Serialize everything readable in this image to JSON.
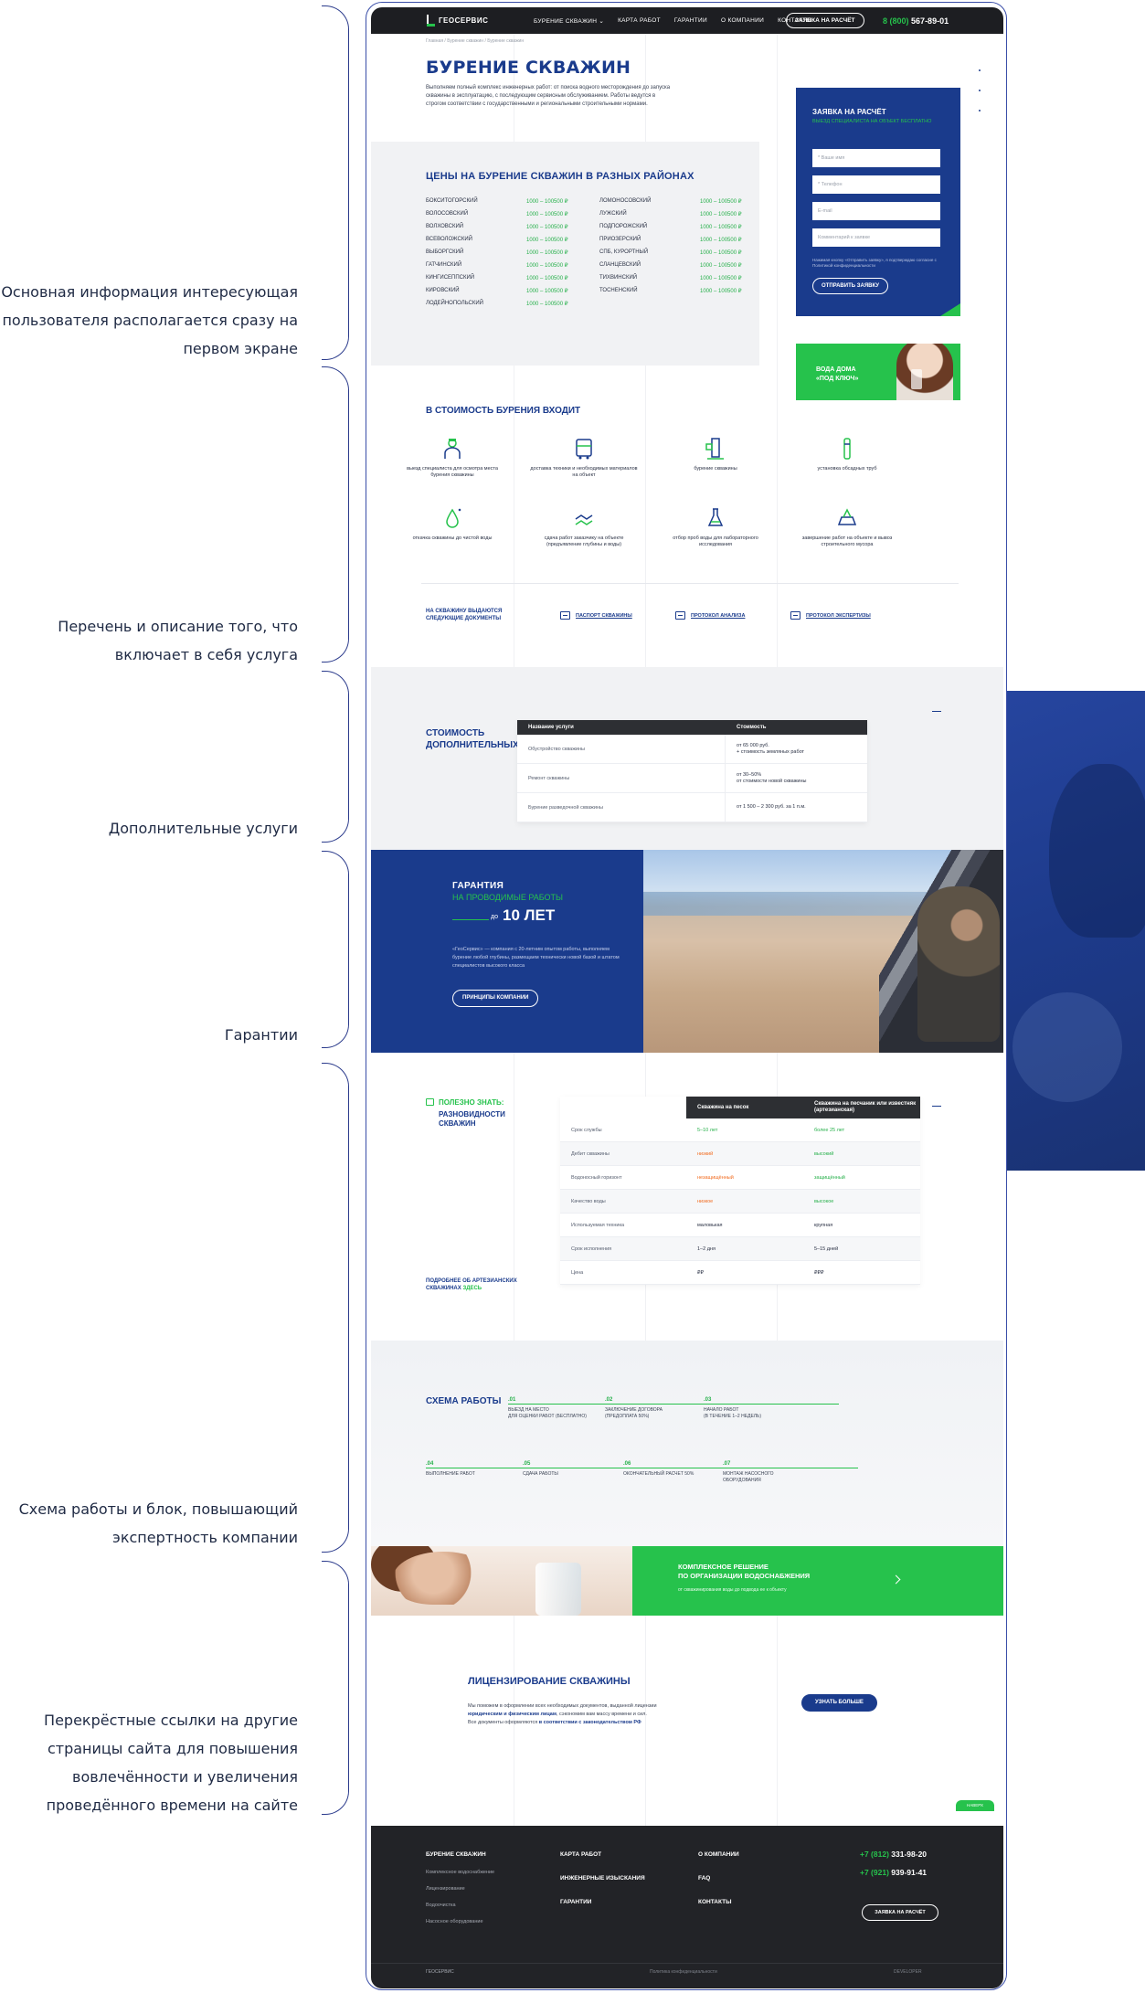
{
  "annotations": [
    "Основная информация интересующая пользователя располагается сразу на первом экране",
    "Перечень и описание того, что включает в себя услуга",
    "Дополнительные услуги",
    "Гарантии",
    "Схема работы и блок, повышающий экспертность компании",
    "Перекрёстные ссылки на другие страницы сайта для повышения вовлечённости и увеличения проведённого времени на сайте"
  ],
  "header": {
    "logo": "ГЕОСЕРВИС",
    "nav": [
      "БУРЕНИЕ СКВАЖИН ⌄",
      "КАРТА РАБОТ",
      "ГАРАНТИИ",
      "О КОМПАНИИ",
      "КОНТАКТЫ"
    ],
    "cta": "ЗАЯВКА НА РАСЧЁТ",
    "phone_prefix": "8 (800)",
    "phone": "567-89-01"
  },
  "breadcrumbs": "Главная / Бурение скважин / Бурение скважин",
  "hero": {
    "title": "БУРЕНИЕ СКВАЖИН",
    "lead": "Выполняем полный комплекс инженерных работ: от поиска водного месторождения до запуска скважины в эксплуатацию, с последующим сервисным обслуживанием. Работы ведутся в строгом соответствии с государственными и региональными строительными нормами."
  },
  "prices": {
    "title": "ЦЕНЫ НА БУРЕНИЕ СКВАЖИН В РАЗНЫХ РАЙОНАХ",
    "left": [
      [
        "БОКСИТОГОРСКИЙ",
        "1000 – 100500 ₽"
      ],
      [
        "ВОЛОСОВСКИЙ",
        "1000 – 100500 ₽"
      ],
      [
        "ВОЛХОВСКИЙ",
        "1000 – 100500 ₽"
      ],
      [
        "ВСЕВОЛОЖСКИЙ",
        "1000 – 100500 ₽"
      ],
      [
        "ВЫБОРГСКИЙ",
        "1000 – 100500 ₽"
      ],
      [
        "ГАТЧИНСКИЙ",
        "1000 – 100500 ₽"
      ],
      [
        "КИНГИСЕППСКИЙ",
        "1000 – 100500 ₽"
      ],
      [
        "КИРОВСКИЙ",
        "1000 – 100500 ₽"
      ],
      [
        "ЛОДЕЙНОПОЛЬСКИЙ",
        "1000 – 100500 ₽"
      ]
    ],
    "right": [
      [
        "ЛОМОНОСОВСКИЙ",
        "1000 – 100500 ₽"
      ],
      [
        "ЛУЖСКИЙ",
        "1000 – 100500 ₽"
      ],
      [
        "ПОДПОРОЖСКИЙ",
        "1000 – 100500 ₽"
      ],
      [
        "ПРИОЗЕРСКИЙ",
        "1000 – 100500 ₽"
      ],
      [
        "СПБ, КУРОРТНЫЙ",
        "1000 – 100500 ₽"
      ],
      [
        "СЛАНЦЕВСКИЙ",
        "1000 – 100500 ₽"
      ],
      [
        "ТИХВИНСКИЙ",
        "1000 – 100500 ₽"
      ],
      [
        "ТОСНЕНСКИЙ",
        "1000 – 100500 ₽"
      ]
    ]
  },
  "form": {
    "title": "ЗАЯВКА НА РАСЧЁТ",
    "subtitle": "ВЫЕЗД СПЕЦИАЛИСТА НА ОБЪЕКТ БЕСПЛАТНО",
    "fields": [
      "* Ваше имя",
      "* Телефон",
      "E-mail",
      "Комментарий к заявке"
    ],
    "note": "Нажимая кнопку «Отправить заявку», я подтверждаю согласие с Политикой конфиденциальности",
    "button": "ОТПРАВИТЬ ЗАЯВКУ"
  },
  "promo": {
    "line1": "ВОДА ДОМА",
    "line2": "«ПОД КЛЮЧ»"
  },
  "includes": {
    "title": "В СТОИМОСТЬ БУРЕНИЯ ВХОДИТ",
    "items": [
      "выезд специалиста для осмотра места бурения скважины",
      "доставка техники и необходимых материалов на объект",
      "бурение скважины",
      "установка обсадных труб",
      "откачка скважины до чистой воды",
      "сдача работ заказчику на объекте (предъявление глубины и воды)",
      "отбор проб воды для лабораторного исследования",
      "завершение работ на объекте и вывоз строительного мусора"
    ],
    "docs_title_1": "НА СКВАЖИНУ ВЫДАЮТСЯ",
    "docs_title_2": "СЛЕДУЮЩИЕ ДОКУМЕНТЫ",
    "docs": [
      "ПАСПОРТ СКВАЖИНЫ",
      "ПРОТОКОЛ АНАЛИЗА",
      "ПРОТОКОЛ ЭКСПЕРТИЗЫ"
    ]
  },
  "additional": {
    "title_1": "СТОИМОСТЬ",
    "title_2": "ДОПОЛНИТЕЛЬНЫХ РАБОТ",
    "head": [
      "Название услуги",
      "Стоимость"
    ],
    "rows": [
      [
        "Обустройство скважины",
        "от 65 000 руб.",
        "+ стоимость земляных работ"
      ],
      [
        "Ремонт скважины",
        "от 30–50%",
        "от стоимости новой скважины"
      ],
      [
        "Бурение разведочной скважины",
        "от 1 500 – 2 300 руб. за 1 п.м.",
        ""
      ]
    ]
  },
  "guarantee": {
    "title": "ГАРАНТИЯ",
    "subtitle": "НА ПРОВОДИМЫЕ РАБОТЫ",
    "do": "до",
    "years": "10 ЛЕТ",
    "desc": "«ГеоСервис» — компания с 20-летним опытом работы, выполняем бурение любой глубины, размещаем технически новой базой и штатом специалистов высокого класса",
    "button": "ПРИНЦИПЫ КОМПАНИИ"
  },
  "types": {
    "label": "ПОЛЕЗНО ЗНАТЬ:",
    "title_1": "РАЗНОВИДНОСТИ",
    "title_2": "СКВАЖИН",
    "more_1": "ПОДРОБНЕЕ ОБ АРТЕЗИАНСКИХ",
    "more_2": "СКВАЖИНАХ",
    "more_link": "ЗДЕСЬ",
    "head": [
      "",
      "Скважина на песок",
      "Скважина на песчаник или известняк (артезианская)"
    ],
    "rows": [
      [
        "Срок службы",
        "5–10 лет",
        "g",
        "более 25 лет",
        "g"
      ],
      [
        "Дебит скважины",
        "низкий",
        "o",
        "высокий",
        "g"
      ],
      [
        "Водоносный горизонт",
        "незащищённый",
        "o",
        "защищённый",
        "g"
      ],
      [
        "Качество воды",
        "низкое",
        "o",
        "высокое",
        "g"
      ],
      [
        "Используемая техника",
        "маловькая",
        "d",
        "крупная",
        "d"
      ],
      [
        "Срок исполнения",
        "1–2 дня",
        "d",
        "5–15 дней",
        "d"
      ],
      [
        "Цена",
        "₽₽",
        "d",
        "₽₽₽",
        "d"
      ]
    ]
  },
  "scheme": {
    "title": "СХЕМА РАБОТЫ",
    "steps": [
      [
        ".01",
        "ВЫЕЗД НА МЕСТО",
        "ДЛЯ ОЦЕНКИ РАБОТ (БЕСПЛАТНО)"
      ],
      [
        ".02",
        "ЗАКЛЮЧЕНИЕ ДОГОВОРА",
        "(ПРЕДОПЛАТА 50%)"
      ],
      [
        ".03",
        "НАЧАЛО РАБОТ",
        "(В ТЕЧЕНИЕ 1–2 НЕДЕЛЬ)"
      ],
      [
        ".04",
        "ВЫПОЛНЕНИЕ РАБОТ",
        ""
      ],
      [
        ".05",
        "СДАЧА РАБОТЫ",
        ""
      ],
      [
        ".06",
        "ОКОНЧАТЕЛЬНЫЙ РАСЧЕТ 50%",
        ""
      ],
      [
        ".07",
        "МОНТАЖ НАСОСНОГО",
        "ОБОРУДОВАНИЯ"
      ]
    ]
  },
  "complex": {
    "title_1": "КОМПЛЕКСНОЕ РЕШЕНИЕ",
    "title_2": "ПО ОРГАНИЗАЦИИ ВОДОСНАБЖЕНИЯ",
    "subtitle": "от скважинирования воды до подвода ее к объекту"
  },
  "license": {
    "title": "ЛИЦЕНЗИРОВАНИЕ СКВАЖИНЫ",
    "p1": "Мы поможем в оформлении всех необходимых документов, выданной лицензии",
    "p2a": "юридическим и физическим лицам",
    "p2b": ", сэкономим вам массу времени и сил.",
    "p3a": "Все документы оформляются ",
    "p3b": "в соответствии с законодательством РФ",
    "button": "УЗНАТЬ БОЛЬШЕ",
    "up": "НАВЕРХ"
  },
  "footer": {
    "col1_title": "БУРЕНИЕ СКВАЖИН",
    "col1_items": [
      "Комплексное водоснабжение",
      "Лицензирование",
      "Водоочистка",
      "Насосное оборудование"
    ],
    "col2": [
      "КАРТА РАБОТ",
      "ИНЖЕНЕРНЫЕ ИЗЫСКАНИЯ",
      "ГАРАНТИИ"
    ],
    "col3": [
      "О КОМПАНИИ",
      "FAQ",
      "КОНТАКТЫ"
    ],
    "phone1_pre": "+7 (812)",
    "phone1": "331-98-20",
    "phone2_pre": "+7 (921)",
    "phone2": "939-91-41",
    "button": "ЗАЯВКА НА РАСЧЁТ",
    "logo": "ГЕОСЕРВИС",
    "privacy": "Политика конфиденциальности",
    "dev": "DEVELOPER"
  }
}
